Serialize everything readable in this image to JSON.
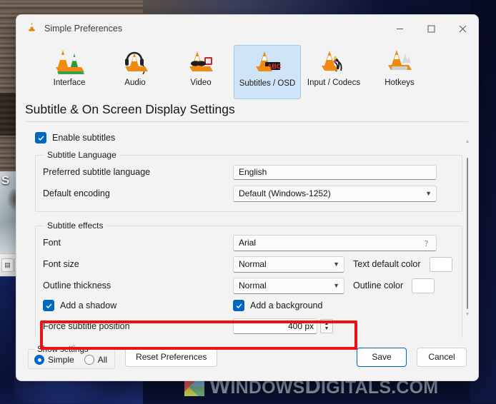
{
  "window": {
    "title": "Simple Preferences",
    "app_icon": "vlc-cone-icon",
    "controls": {
      "minimize": "─",
      "maximize": "☐",
      "close": "✕"
    }
  },
  "categories": [
    {
      "label": "Interface",
      "icon": "vlc-cone-interface-icon",
      "selected": false
    },
    {
      "label": "Audio",
      "icon": "vlc-cone-headphones-icon",
      "selected": false
    },
    {
      "label": "Video",
      "icon": "vlc-cone-glasses-icon",
      "selected": false
    },
    {
      "label": "Subtitles / OSD",
      "icon": "vlc-cone-subtitle-icon",
      "selected": true
    },
    {
      "label": "Input / Codecs",
      "icon": "vlc-cone-cables-icon",
      "selected": false
    },
    {
      "label": "Hotkeys",
      "icon": "vlc-cone-keyboard-icon",
      "selected": false
    }
  ],
  "page": {
    "heading": "Subtitle & On Screen Display Settings",
    "enable_subtitles": {
      "label": "Enable subtitles",
      "checked": true
    },
    "language_group": {
      "legend": "Subtitle Language",
      "rows": [
        {
          "label": "Preferred subtitle language",
          "value": "English",
          "type": "text"
        },
        {
          "label": "Default encoding",
          "value": "Default (Windows-1252)",
          "type": "combo"
        }
      ]
    },
    "effects_group": {
      "legend": "Subtitle effects",
      "font": {
        "label": "Font",
        "value": "Arial"
      },
      "font_size": {
        "label": "Font size",
        "value": "Normal"
      },
      "outline_thickness": {
        "label": "Outline thickness",
        "value": "Normal"
      },
      "text_default_color": {
        "label": "Text default color",
        "color": "#ffffff"
      },
      "outline_color": {
        "label": "Outline color",
        "color": "#000000"
      },
      "add_shadow": {
        "label": "Add a shadow",
        "checked": true
      },
      "add_background": {
        "label": "Add a background",
        "checked": true
      },
      "force_position": {
        "label": "Force subtitle position",
        "value": "400 px"
      }
    }
  },
  "footer": {
    "show_settings": {
      "legend": "Show settings",
      "options": [
        {
          "label": "Simple",
          "selected": true
        },
        {
          "label": "All",
          "selected": false
        }
      ]
    },
    "reset_button": "Reset Preferences",
    "save_button": "Save",
    "cancel_button": "Cancel"
  },
  "annotation": {
    "color": "#ee1111",
    "target": "Force subtitle position"
  },
  "watermark": {
    "part1_cap": "W",
    "part1": "INDOWS",
    "part2_cap": "D",
    "part2": "IGITALS.COM"
  },
  "desktop": {
    "partial_letter": "S"
  }
}
